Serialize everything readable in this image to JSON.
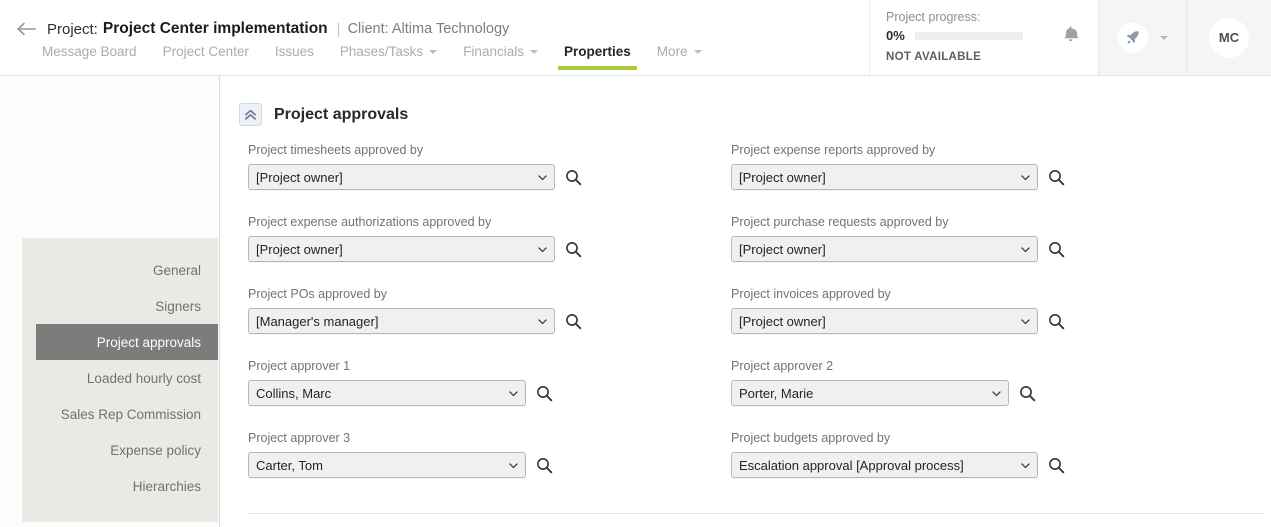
{
  "header": {
    "back_icon": "back-arrow-icon",
    "project_prefix": "Project:",
    "project_name": "Project Center implementation",
    "separator": "|",
    "client_label": "Client: Altima Technology",
    "tabs": [
      {
        "label": "Message Board",
        "active": false,
        "has_caret": false
      },
      {
        "label": "Project Center",
        "active": false,
        "has_caret": false
      },
      {
        "label": "Issues",
        "active": false,
        "has_caret": false
      },
      {
        "label": "Phases/Tasks",
        "active": false,
        "has_caret": true
      },
      {
        "label": "Financials",
        "active": false,
        "has_caret": true
      },
      {
        "label": "Properties",
        "active": true,
        "has_caret": false
      },
      {
        "label": "More",
        "active": false,
        "has_caret": true
      }
    ],
    "progress": {
      "label": "Project progress:",
      "percent_text": "0%",
      "percent_value": 0,
      "status": "NOT AVAILABLE"
    },
    "bell_icon": "notification-bell-icon",
    "rocket_icon": "rocket-icon",
    "rocket_caret_icon": "chevron-down-icon",
    "avatar_initials": "MC"
  },
  "sidebar": {
    "items": [
      {
        "label": "General",
        "active": false
      },
      {
        "label": "Signers",
        "active": false
      },
      {
        "label": "Project approvals",
        "active": true
      },
      {
        "label": "Loaded hourly cost",
        "active": false
      },
      {
        "label": "Sales Rep Commission",
        "active": false
      },
      {
        "label": "Expense policy",
        "active": false
      },
      {
        "label": "Hierarchies",
        "active": false
      }
    ]
  },
  "section": {
    "collapse_icon": "chevrons-up-icon",
    "title": "Project approvals"
  },
  "form": {
    "search_icon": "search-magnifier-icon",
    "select_arrow_icon": "chevron-down-icon",
    "rows": [
      {
        "left": {
          "label": "Project timesheets approved by",
          "value": "[Project owner]",
          "width": "wide"
        },
        "right": {
          "label": "Project expense reports approved by",
          "value": "[Project owner]",
          "width": "wide"
        }
      },
      {
        "left": {
          "label": "Project expense authorizations approved by",
          "value": "[Project owner]",
          "width": "wide"
        },
        "right": {
          "label": "Project purchase requests approved by",
          "value": "[Project owner]",
          "width": "wide"
        }
      },
      {
        "left": {
          "label": "Project POs approved by",
          "value": "[Manager's manager]",
          "width": "wide"
        },
        "right": {
          "label": "Project invoices approved by",
          "value": "[Project owner]",
          "width": "wide"
        }
      },
      {
        "left": {
          "label": "Project approver 1",
          "value": "Collins, Marc",
          "width": "narrow"
        },
        "right": {
          "label": "Project approver 2",
          "value": "Porter, Marie",
          "width": "narrow"
        }
      },
      {
        "left": {
          "label": "Project approver 3",
          "value": "Carter, Tom",
          "width": "narrow"
        },
        "right": {
          "label": "Project budgets approved by",
          "value": "Escalation approval [Approval process]",
          "width": "wide"
        }
      }
    ]
  },
  "colors": {
    "accent_green": "#a8cc3e",
    "active_nav_bg": "#7c7c7c",
    "sidebar_bg": "#eaeae5"
  }
}
